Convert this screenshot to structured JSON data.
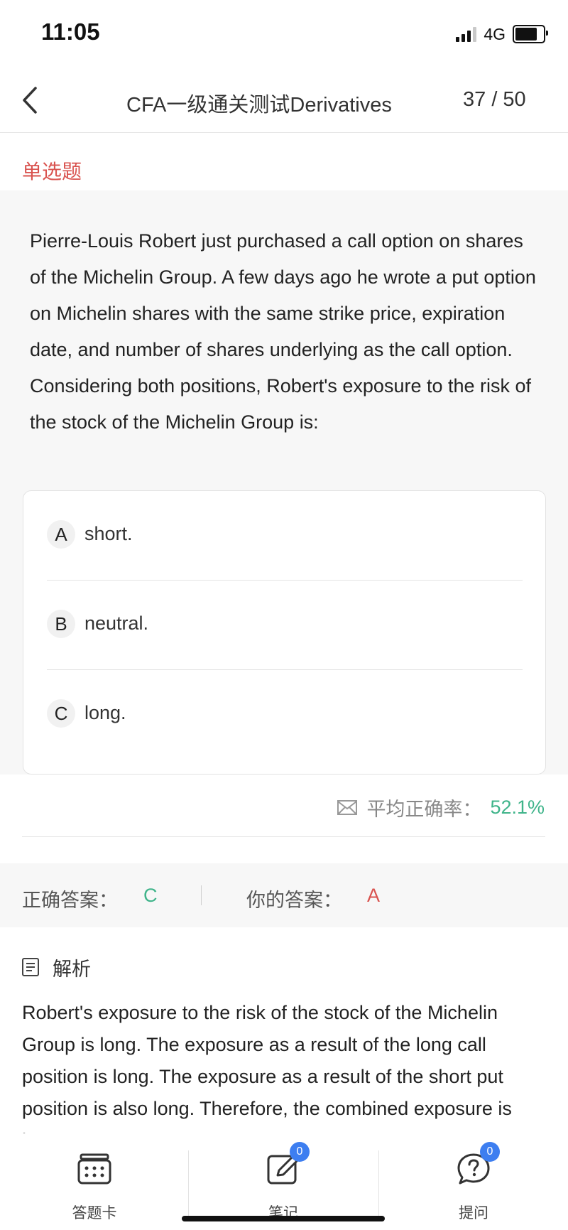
{
  "status_bar": {
    "time": "11:05",
    "network": "4G",
    "signal_level": 3,
    "battery_level_fraction": 0.8
  },
  "nav": {
    "title": "CFA一级通关测试Derivatives",
    "progress": "37 / 50",
    "back_icon": "chevron-left-icon"
  },
  "question": {
    "type_label": "单选题",
    "text": "Pierre-Louis Robert just purchased a call option on shares of the Michelin Group. A few days ago he wrote a put option on Michelin shares with the same strike price, expiration date, and number of shares underlying as the call option. Considering both positions, Robert's exposure to the risk of the stock of the Michelin Group is:",
    "options": [
      {
        "letter": "A",
        "text": "short."
      },
      {
        "letter": "B",
        "text": "neutral."
      },
      {
        "letter": "C",
        "text": "long."
      }
    ]
  },
  "stats": {
    "icon": "envelope-icon",
    "label": "平均正确率：",
    "value": "52.1%"
  },
  "answers": {
    "correct_label": "正确答案：",
    "correct_value": "C",
    "yours_label": "你的答案：",
    "yours_value": "A",
    "correct_color": "#3fb48a",
    "wrong_color": "#d9534f"
  },
  "analysis": {
    "icon": "document-icon",
    "title": "解析",
    "text": "Robert's exposure to the risk of the stock of the Michelin Group is long. The exposure as a result of the long call position is long. The exposure as a result of the short put position is also long. Therefore, the combined exposure is long."
  },
  "tabs": [
    {
      "label": "答题卡",
      "icon": "answer-card-icon"
    },
    {
      "label": "笔记",
      "icon": "note-edit-icon",
      "badge": "0"
    },
    {
      "label": "提问",
      "icon": "question-bubble-icon",
      "badge": "0"
    }
  ],
  "colors": {
    "accent_red": "#d9534f",
    "accent_green": "#3fb48a",
    "badge_blue": "#3d7ef0"
  }
}
